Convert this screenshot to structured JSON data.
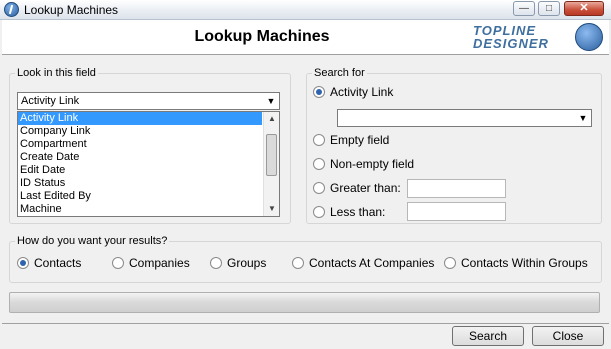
{
  "window": {
    "title": "Lookup Machines",
    "minimize_icon": "minimize-icon",
    "maximize_icon": "maximize-icon",
    "close_icon": "close-icon"
  },
  "header": {
    "heading": "Lookup Machines",
    "logo_line1": "TopLine",
    "logo_line2": "Designer"
  },
  "look_in": {
    "legend": "Look in this field",
    "selected": "Activity Link",
    "options": [
      "Activity Link",
      "Company Link",
      "Compartment",
      "Create Date",
      "Edit Date",
      "ID Status",
      "Last Edited By",
      "Machine"
    ]
  },
  "search_for": {
    "legend": "Search for",
    "activity_link_label": "Activity Link",
    "activity_link_value": "",
    "empty_label": "Empty field",
    "nonempty_label": "Non-empty field",
    "greater_label": "Greater than:",
    "greater_value": "",
    "less_label": "Less than:",
    "less_value": ""
  },
  "results": {
    "legend": "How do you want your results?",
    "options": [
      "Contacts",
      "Companies",
      "Groups",
      "Contacts At Companies",
      "Contacts Within Groups"
    ],
    "selected": "Contacts"
  },
  "progress": {
    "value": 0
  },
  "buttons": {
    "search": "Search",
    "close": "Close"
  }
}
